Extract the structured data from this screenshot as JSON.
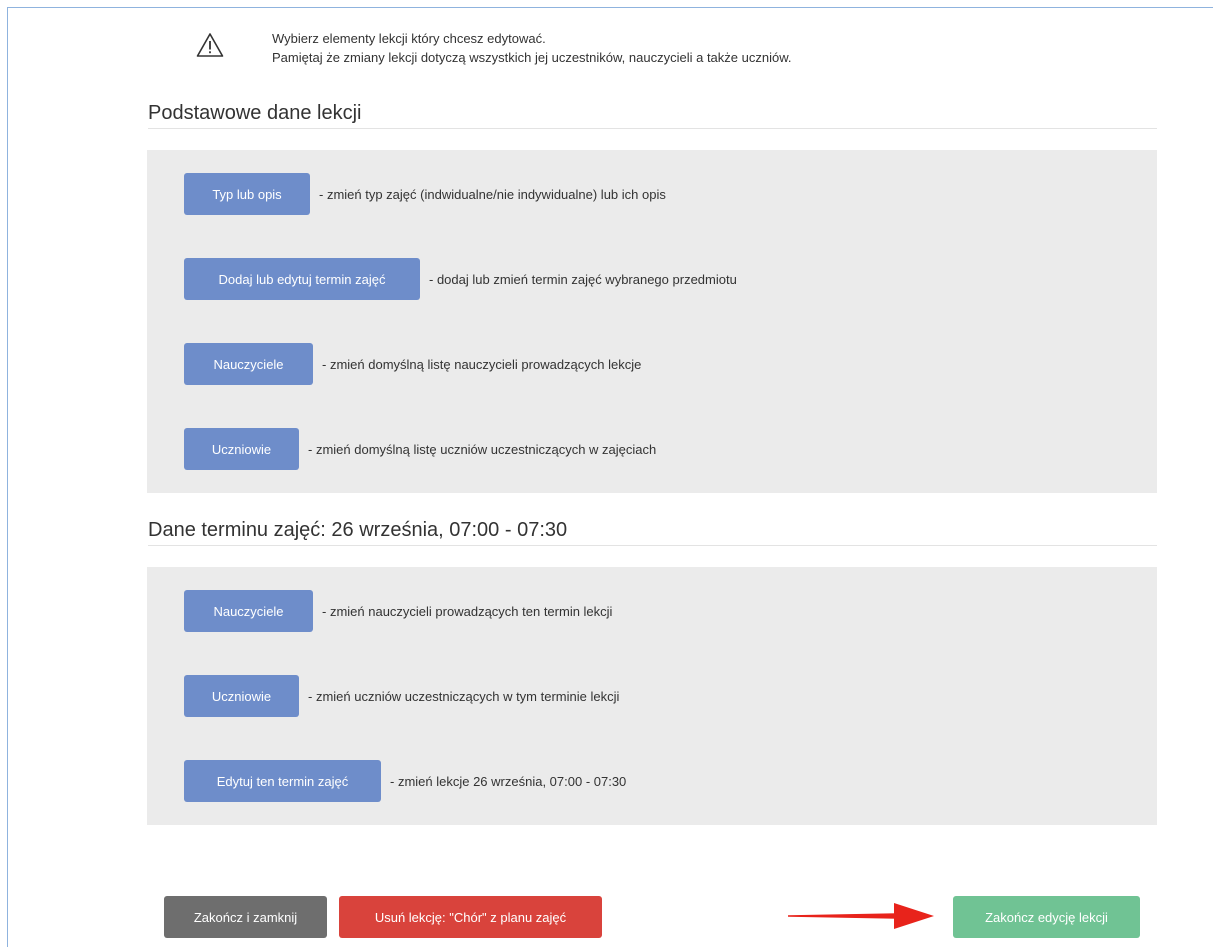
{
  "notice": {
    "icon": "warning-icon",
    "line1": "Wybierz elementy lekcji który chcesz edytować.",
    "line2": "Pamiętaj że zmiany lekcji dotyczą wszystkich jej uczestników, nauczycieli a także uczniów."
  },
  "basic_section": {
    "title": "Podstawowe dane lekcji",
    "items": [
      {
        "label": "Typ lub opis",
        "description": "- zmień typ zajęć (indwidualne/nie indywidualne) lub ich opis"
      },
      {
        "label": "Dodaj lub edytuj termin zajęć",
        "description": "- dodaj lub zmień termin zajęć wybranego przedmiotu"
      },
      {
        "label": "Nauczyciele",
        "description": "- zmień domyślną listę nauczycieli prowadzących lekcje"
      },
      {
        "label": "Uczniowie",
        "description": "- zmień domyślną listę uczniów uczestniczących w zajęciach"
      }
    ]
  },
  "term_section": {
    "title": "Dane terminu zajęć: 26 września, 07:00 - 07:30",
    "items": [
      {
        "label": "Nauczyciele",
        "description": "- zmień nauczycieli prowadzących ten termin lekcji"
      },
      {
        "label": "Uczniowie",
        "description": "- zmień uczniów uczestniczących w tym terminie lekcji"
      },
      {
        "label": "Edytuj ten termin zajęć",
        "description": "- zmień lekcje 26 września, 07:00 - 07:30"
      }
    ]
  },
  "footer": {
    "close_label": "Zakończ i zamknij",
    "delete_label": "Usuń lekcję: \"Chór\" z planu zajęć",
    "finish_label": "Zakończ edycję lekcji"
  },
  "annotation": {
    "icon": "arrow-right-icon"
  },
  "colors": {
    "frame": "#8fb3de",
    "blue": "#6e8dca",
    "panel": "#ebebeb",
    "rule": "#e3e3e3",
    "gray": "#6e6e6e",
    "red": "#d9433c",
    "green": "#70c394",
    "arrow": "#e8231b",
    "text": "#333333"
  }
}
